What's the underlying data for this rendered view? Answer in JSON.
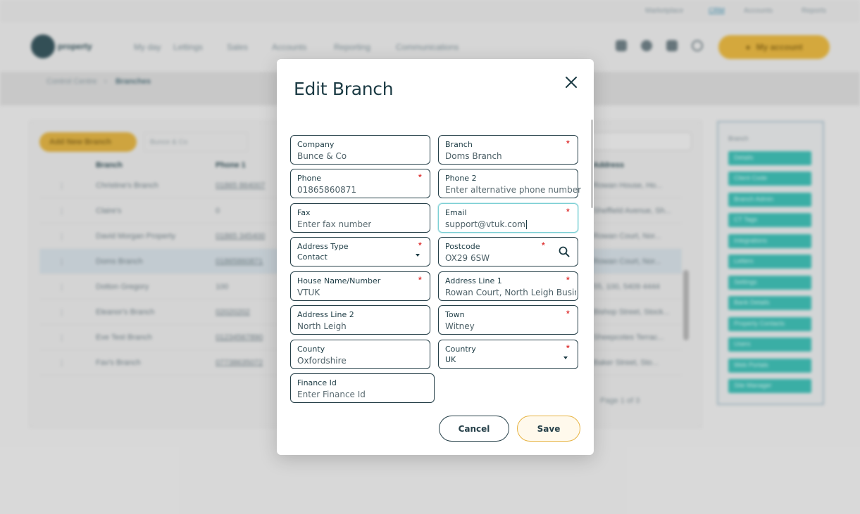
{
  "background": {
    "top_links": [
      "Marketplace",
      "CRM",
      "Accounts",
      "Reports"
    ],
    "brand": "property",
    "nav": [
      "My day",
      "Lettings",
      "Sales",
      "Accounts",
      "Reporting",
      "Communications"
    ],
    "account_button": "My account",
    "breadcrumb": [
      "Control Centre",
      "Branches"
    ],
    "add_button": "Add New Branch",
    "filter_placeholder": "Bunce & Co",
    "columns": [
      "Branch",
      "Phone 1",
      "Address"
    ],
    "rows": [
      {
        "name": "Christine's Branch",
        "phone": "01865 864007",
        "address": "Rowan House, Ho..."
      },
      {
        "name": "Claire's",
        "phone": "0",
        "address": "Sheffield Avenue, Sh..."
      },
      {
        "name": "David Morgan Property",
        "phone": "01865 345400",
        "address": "Rowan Court, Nor..."
      },
      {
        "name": "Doms Branch",
        "phone": "01865860871",
        "address": "Rowan Court, Nor..."
      },
      {
        "name": "Dotton Gregory",
        "phone": "100",
        "address": "55, 100, 5409 4444"
      },
      {
        "name": "Eleanor's Branch",
        "phone": "02020202",
        "address": "Bishop Street, Stock..."
      },
      {
        "name": "Eve Test Branch",
        "phone": "01234567890",
        "address": "Sheepcotes Terrac..."
      },
      {
        "name": "Fav's Branch",
        "phone": "07738635072",
        "address": "Baker Street, Sto..."
      }
    ],
    "pager": "Page 1 of 3",
    "side_label": "Branch",
    "side_chips": [
      "Details",
      "Client Code",
      "Branch Admin",
      "CT Tags",
      "Integrations",
      "Letters",
      "Settings",
      "Bank Details",
      "Property Contacts",
      "Users",
      "Web Portals",
      "Site Manager"
    ]
  },
  "modal": {
    "title": "Edit Branch",
    "fields": {
      "company": {
        "label": "Company",
        "value": "Bunce & Co"
      },
      "branch": {
        "label": "Branch",
        "value": "Doms Branch",
        "required": "*"
      },
      "phone": {
        "label": "Phone",
        "value": "01865860871",
        "required": "*"
      },
      "phone2": {
        "label": "Phone 2",
        "placeholder": "Enter alternative phone number"
      },
      "fax": {
        "label": "Fax",
        "placeholder": "Enter fax number"
      },
      "email": {
        "label": "Email",
        "value": "support@vtuk.com",
        "required": "*"
      },
      "address_type": {
        "label": "Address Type",
        "value": "Contact",
        "required": "*"
      },
      "postcode": {
        "label": "Postcode",
        "value": "OX29 6SW",
        "required": "*"
      },
      "house": {
        "label": "House Name/Number",
        "value": "VTUK",
        "required": "*"
      },
      "address1": {
        "label": "Address Line 1",
        "value": "Rowan Court, North Leigh Business Park",
        "required": "*"
      },
      "address2": {
        "label": "Address Line 2",
        "value": "North Leigh"
      },
      "town": {
        "label": "Town",
        "value": "Witney",
        "required": "*"
      },
      "county": {
        "label": "County",
        "value": "Oxfordshire"
      },
      "country": {
        "label": "Country",
        "value": "UK",
        "required": "*"
      },
      "finance_id": {
        "label": "Finance Id",
        "placeholder": "Enter Finance Id"
      }
    },
    "cancel_label": "Cancel",
    "save_label": "Save"
  },
  "colors": {
    "accent": "#e7b341",
    "focus": "#7ccfd4",
    "dark": "#1c3b44",
    "required": "#e03b3b",
    "teal_chip": "#3cb7ae"
  }
}
